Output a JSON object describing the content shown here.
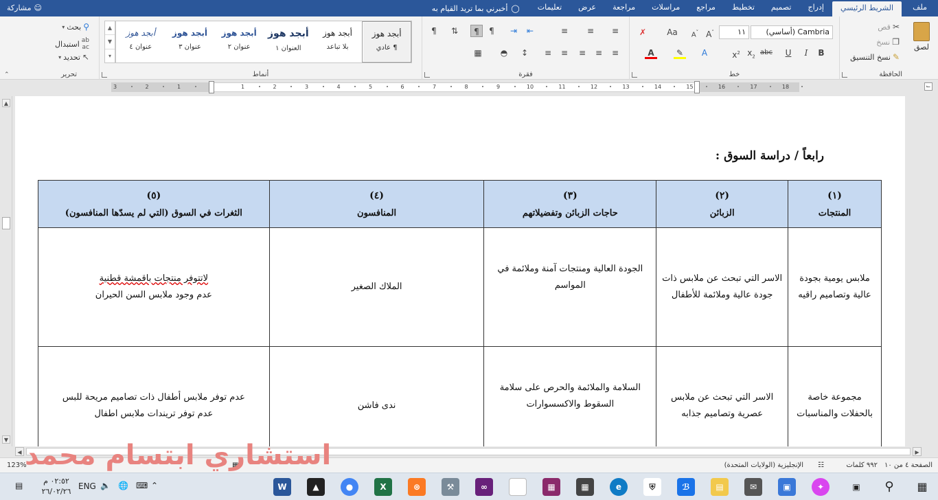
{
  "tabs": {
    "file": "ملف",
    "home": "الشريط الرئيسي",
    "insert": "إدراج",
    "design": "تصميم",
    "layout": "تخطيط",
    "references": "مراجع",
    "mailings": "مراسلات",
    "review": "مراجعة",
    "view": "عرض",
    "help": "تعليمات",
    "tell_me": "أخبرني بما تريد القيام به",
    "share": "مشاركة"
  },
  "clipboard": {
    "paste": "لصق",
    "cut": "قص",
    "copy": "نسخ",
    "format_painter": "نسخ التنسيق",
    "label": "الحافظة"
  },
  "font": {
    "name": "Cambria (أساسي)",
    "size": "١١",
    "label": "خط"
  },
  "paragraph": {
    "label": "فقرة"
  },
  "styles": {
    "label": "أنماط",
    "items": [
      {
        "sample": "أبجد هوز",
        "name": "¶ عادي"
      },
      {
        "sample": "أبجد هوز",
        "name": "بلا تباعد"
      },
      {
        "sample": "أبجد هوز",
        "name": "العنوان ١"
      },
      {
        "sample": "أبجد هوز",
        "name": "عنوان ٢"
      },
      {
        "sample": "أبجد هوز",
        "name": "عنوان ٣"
      },
      {
        "sample": "أبجد هوز",
        "name": "عنوان ٤"
      }
    ]
  },
  "editing": {
    "find": "بحث",
    "replace": "استبدال",
    "select": "تحديد",
    "label": "تحرير"
  },
  "ruler_ticks": [
    "3",
    "2",
    "1",
    "1",
    "2",
    "3",
    "4",
    "5",
    "6",
    "7",
    "8",
    "9",
    "10",
    "11",
    "12",
    "13",
    "14",
    "15",
    "16",
    "17",
    "18"
  ],
  "document": {
    "heading": "رابعاً / دراسة السوق :",
    "columns": [
      {
        "num": "(١)",
        "title": "المنتجات"
      },
      {
        "num": "(٢)",
        "title": "الزبائن"
      },
      {
        "num": "(٣)",
        "title": "حاجات الزبائن وتفضيلاتهم"
      },
      {
        "num": "(٤)",
        "title": "المنافسون"
      },
      {
        "num": "(٥)",
        "title": "الثغرات في السوق (التي لم يسدّها المنافسون)"
      }
    ],
    "rows": [
      {
        "products": "ملابس يومية بجودة عالية وتصاميم راقيه",
        "customers": "الاسر التي تبحث عن ملابس ذات جودة عالية وملائمة للأطفال",
        "needs": "الجودة العالية ومنتجات آمنة وملائمة في المواسم",
        "competitors": "الملاك الصغير",
        "gaps_line1": "لاتتوفر منتجات باقمشة قطنية",
        "gaps_line2": "عدم وجود ملابس السن الحيران"
      },
      {
        "products": "مجموعة خاصة بالحفلات والمناسبات",
        "customers": "الاسر التي تبحث عن ملابس عصرية وتصاميم جذابه",
        "needs": "السلامة والملائمة والحرص على سلامة السقوط والاكسسوارات",
        "competitors": "ندى فاشن",
        "gaps_line1": "عدم توفر ملابس أطفال ذات تصاميم مريحة للبس",
        "gaps_line2": "عدم توفر تريندات ملابس اطفال"
      }
    ]
  },
  "status": {
    "page": "الصفحة ٤ من ١٠",
    "words": "٩٩٢ كلمات",
    "language": "الإنجليزية (الولايات المتحدة)",
    "zoom": "123%"
  },
  "watermark": "استشاري ابتسام محمد",
  "taskbar": {
    "time": "٠٢:٥٢ م",
    "date": "٢٦/٠٢/٢٦",
    "lang": "ENG"
  }
}
